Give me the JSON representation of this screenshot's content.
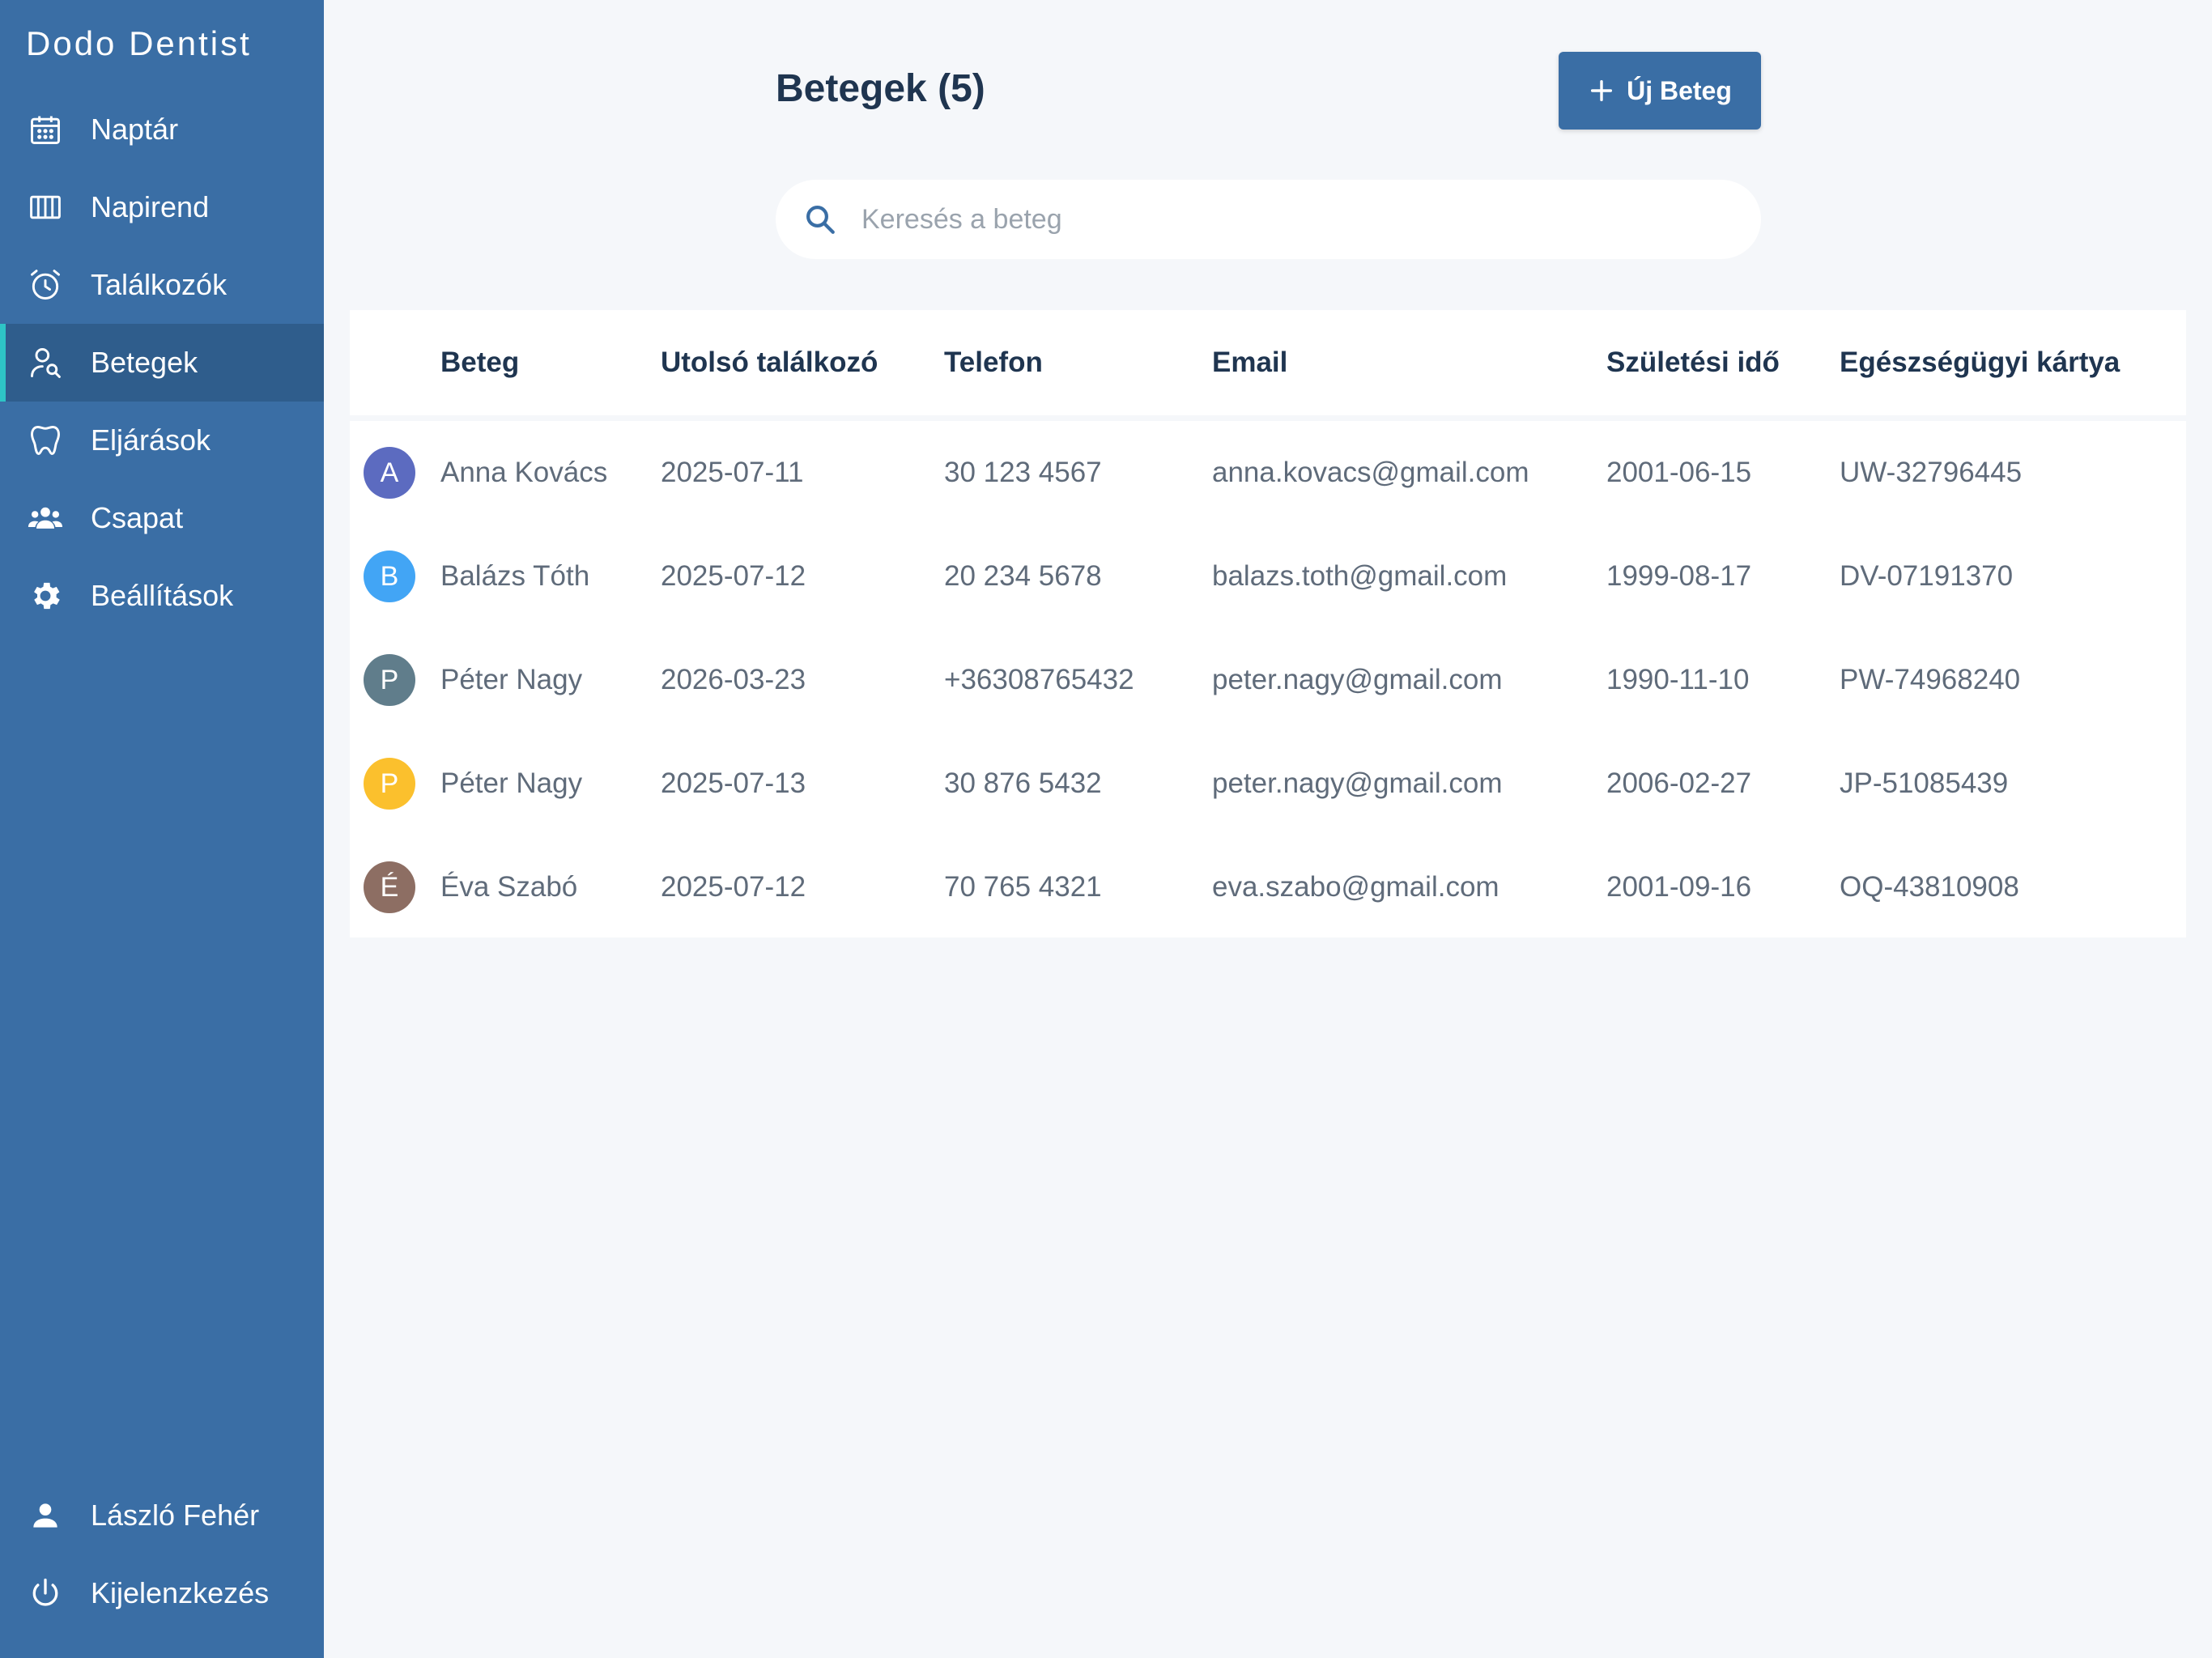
{
  "app": {
    "brand": "Dodo Dentist"
  },
  "sidebar": {
    "items": [
      {
        "label": "Naptár",
        "icon": "calendar-icon",
        "active": false
      },
      {
        "label": "Napirend",
        "icon": "columns-icon",
        "active": false
      },
      {
        "label": "Találkozók",
        "icon": "alarm-clock-icon",
        "active": false
      },
      {
        "label": "Betegek",
        "icon": "patient-search-icon",
        "active": true
      },
      {
        "label": "Eljárások",
        "icon": "tooth-icon",
        "active": false
      },
      {
        "label": "Csapat",
        "icon": "team-icon",
        "active": false
      },
      {
        "label": "Beállítások",
        "icon": "gear-icon",
        "active": false
      }
    ],
    "user": {
      "label": "László Fehér",
      "icon": "user-icon"
    },
    "logout": {
      "label": "Kijelenzkezés",
      "icon": "power-icon"
    }
  },
  "header": {
    "title": "Betegek (5)",
    "new_button_label": "Új Beteg"
  },
  "search": {
    "placeholder": "Keresés a beteg",
    "value": ""
  },
  "table": {
    "columns": [
      "Beteg",
      "Utolsó találkozó",
      "Telefon",
      "Email",
      "Születési idő",
      "Egészségügyi kártya"
    ],
    "rows": [
      {
        "initial": "A",
        "avatar_color": "#5c6bc0",
        "name": "Anna Kovács",
        "last_visit": "2025-07-11",
        "phone": "30 123 4567",
        "email": "anna.kovacs@gmail.com",
        "birth": "2001-06-15",
        "card": "UW-32796445"
      },
      {
        "initial": "B",
        "avatar_color": "#42a5f5",
        "name": "Balázs Tóth",
        "last_visit": "2025-07-12",
        "phone": "20 234 5678",
        "email": "balazs.toth@gmail.com",
        "birth": "1999-08-17",
        "card": "DV-07191370"
      },
      {
        "initial": "P",
        "avatar_color": "#607d8b",
        "name": "Péter Nagy",
        "last_visit": "2026-03-23",
        "phone": "+36308765432",
        "email": "peter.nagy@gmail.com",
        "birth": "1990-11-10",
        "card": "PW-74968240"
      },
      {
        "initial": "P",
        "avatar_color": "#fbc02d",
        "name": "Péter Nagy",
        "last_visit": "2025-07-13",
        "phone": "30 876 5432",
        "email": "peter.nagy@gmail.com",
        "birth": "2006-02-27",
        "card": "JP-51085439"
      },
      {
        "initial": "É",
        "avatar_color": "#8d6e63",
        "name": "Éva Szabó",
        "last_visit": "2025-07-12",
        "phone": "70 765 4321",
        "email": "eva.szabo@gmail.com",
        "birth": "2001-09-16",
        "card": "OQ-43810908"
      }
    ]
  },
  "colors": {
    "sidebar_bg": "#3a6ea5",
    "sidebar_active_bg": "#2f5d8c",
    "active_indicator": "#2ec4c6",
    "primary": "#3a6ea5",
    "page_bg": "#f5f7fa"
  }
}
